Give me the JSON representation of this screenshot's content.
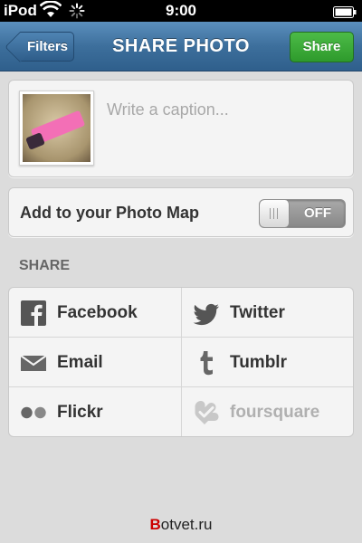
{
  "status_bar": {
    "carrier": "iPod",
    "time": "9:00"
  },
  "nav": {
    "back_label": "Filters",
    "title": "SHARE PHOTO",
    "action_label": "Share"
  },
  "caption": {
    "placeholder": "Write a caption..."
  },
  "photo_map": {
    "label": "Add to your Photo Map",
    "toggle_state": "OFF"
  },
  "share_section": {
    "header": "SHARE",
    "services": [
      {
        "label": "Facebook",
        "icon": "facebook-icon",
        "enabled": true
      },
      {
        "label": "Twitter",
        "icon": "twitter-icon",
        "enabled": true
      },
      {
        "label": "Email",
        "icon": "email-icon",
        "enabled": true
      },
      {
        "label": "Tumblr",
        "icon": "tumblr-icon",
        "enabled": true
      },
      {
        "label": "Flickr",
        "icon": "flickr-icon",
        "enabled": true
      },
      {
        "label": "foursquare",
        "icon": "foursquare-icon",
        "enabled": false
      }
    ]
  },
  "watermark": {
    "first_letter": "B",
    "rest": "otvet.ru"
  },
  "colors": {
    "nav_blue": "#3d6f9c",
    "share_green": "#2e9a2c",
    "flickr_dot": "#555555"
  }
}
